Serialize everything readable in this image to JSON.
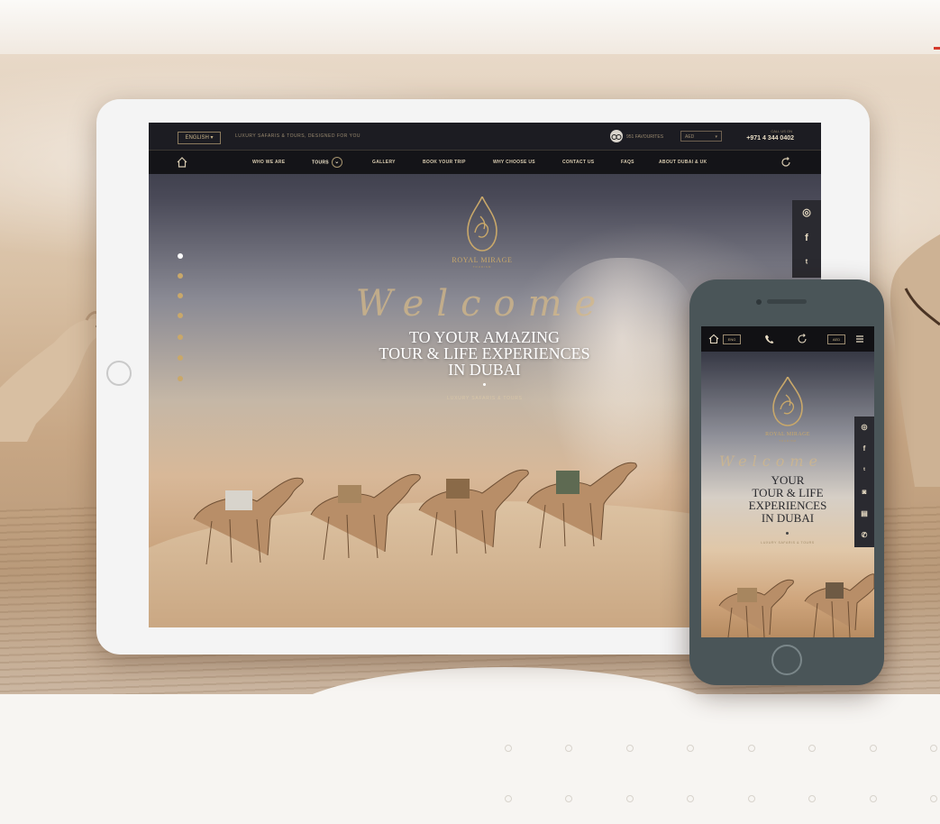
{
  "colors": {
    "accent_gold": "#c9a86a",
    "nav_bg": "#141418",
    "brand_red": "#d43a2c"
  },
  "tablet": {
    "topbar": {
      "language": "ENGLISH ▾",
      "tagline": "LUXURY SAFARIS & TOURS, DESIGNED FOR YOU",
      "reviews": "951 FAVOURITES",
      "currency": "AED",
      "call_label": "CALL US ON",
      "phone": "+971 4 344 0402"
    },
    "nav": {
      "items": [
        {
          "label": "WHO WE ARE"
        },
        {
          "label": "TOURS"
        },
        {
          "label": "GALLERY"
        },
        {
          "label": "BOOK YOUR TRIP"
        },
        {
          "label": "WHY CHOOSE US"
        },
        {
          "label": "CONTACT US"
        },
        {
          "label": "FAQS"
        },
        {
          "label": "ABOUT DUBAI & UK"
        }
      ]
    },
    "hero": {
      "brand": "ROYAL MIRAGE",
      "brand_sub": "TOURISM",
      "script": "Welcome",
      "line1": "TO YOUR AMAZING",
      "line2": "TOUR & LIFE EXPERIENCES",
      "line3": "IN DUBAI",
      "subtitle": "LUXURY SAFARIS & TOURS"
    },
    "social": [
      {
        "icon": "tripadvisor-icon",
        "glyph": "◎"
      },
      {
        "icon": "facebook-icon",
        "glyph": "f"
      },
      {
        "icon": "twitter-icon",
        "glyph": "ᵗ"
      }
    ]
  },
  "phone": {
    "topbar": {
      "lang": "ENG",
      "curr": "AED"
    },
    "hero": {
      "brand": "ROYAL MIRAGE",
      "brand_sub": "TOURISM",
      "script": "Welcome",
      "line1": "YOUR",
      "line2": "TOUR & LIFE",
      "line3": "EXPERIENCES",
      "line4": "IN DUBAI",
      "subtitle": "LUXURY SAFARIS & TOURS"
    },
    "social": [
      {
        "icon": "tripadvisor-icon",
        "glyph": "◎"
      },
      {
        "icon": "facebook-icon",
        "glyph": "f"
      },
      {
        "icon": "twitter-icon",
        "glyph": "ᵗ"
      },
      {
        "icon": "instagram-icon",
        "glyph": "◙"
      },
      {
        "icon": "printer-icon",
        "glyph": "▤"
      },
      {
        "icon": "whatsapp-icon",
        "glyph": "✆"
      }
    ]
  }
}
